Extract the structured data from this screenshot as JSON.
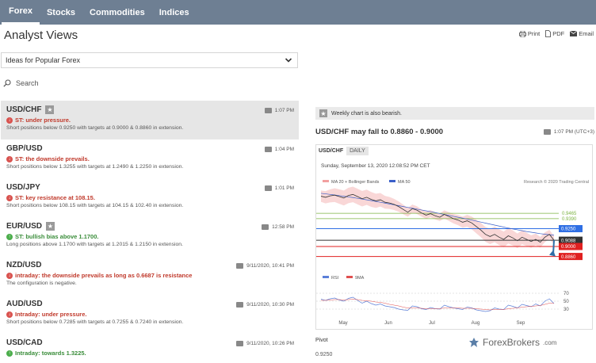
{
  "nav": {
    "tabs": [
      {
        "label": "Forex",
        "active": true
      },
      {
        "label": "Stocks",
        "active": false
      },
      {
        "label": "Commodities",
        "active": false
      },
      {
        "label": "Indices",
        "active": false
      }
    ]
  },
  "page": {
    "title": "Analyst Views"
  },
  "toolbar": {
    "print": "Print",
    "pdf": "PDF",
    "email": "Email"
  },
  "filter": {
    "selected": "Ideas for Popular Forex"
  },
  "search": {
    "label": "Search"
  },
  "ideas": [
    {
      "pair": "USD/CHF",
      "star": true,
      "time": "1:07 PM",
      "direction": "down",
      "headline": "ST: under pressure.",
      "desc": "Short positions below 0.9250 with targets at 0.9000 & 0.8860 in extension."
    },
    {
      "pair": "GBP/USD",
      "star": false,
      "time": "1:04 PM",
      "direction": "down",
      "headline": "ST: the downside prevails.",
      "desc": "Short positions below 1.3255 with targets at 1.2490 & 1.2250 in extension."
    },
    {
      "pair": "USD/JPY",
      "star": false,
      "time": "1:01 PM",
      "direction": "down",
      "headline": "ST: key resistance at 108.15.",
      "desc": "Short positions below 108.15 with targets at 104.15 & 102.40 in extension."
    },
    {
      "pair": "EUR/USD",
      "star": true,
      "time": "12:58 PM",
      "direction": "up",
      "headline": "ST: bullish bias above 1.1700.",
      "desc": "Long positions above 1.1700 with targets at 1.2015 & 1.2150 in extension."
    },
    {
      "pair": "NZD/USD",
      "star": false,
      "time": "9/11/2020, 10:41 PM",
      "direction": "down",
      "headline": "intraday: the downside prevails as long as 0.6687 is resistance",
      "desc": "The configuration is negative."
    },
    {
      "pair": "AUD/USD",
      "star": false,
      "time": "9/11/2020, 10:30 PM",
      "direction": "down",
      "headline": "Intraday: under pressure.",
      "desc": "Short positions below 0.7285 with targets at 0.7255 & 0.7240 in extension."
    },
    {
      "pair": "USD/CAD",
      "star": false,
      "time": "9/11/2020, 10:26 PM",
      "direction": "up",
      "headline": "Intraday: towards 1.3225.",
      "desc": ""
    }
  ],
  "detail": {
    "note": "Weekly chart is also bearish.",
    "title": "USD/CHF may fall to 0.8860 - 0.9000",
    "time": "1:07 PM (UTC+3)",
    "pivot_label": "Pivot",
    "pivot_value": "0.9250"
  },
  "chart_data": {
    "type": "line",
    "symbol": "USD/CHF",
    "timeframe": "DAILY",
    "date": "Sunday, September 13, 2020 12:08:52 PM CET",
    "legend": [
      "MA 20 + Bollinger Bands",
      "MA 50"
    ],
    "credit": "Research © 2020 Trading Central",
    "x_labels": [
      "May",
      "Jun",
      "Jul",
      "Aug",
      "Sep"
    ],
    "levels": [
      {
        "value": 0.9465,
        "color": "#7cb342"
      },
      {
        "value": 0.939,
        "color": "#7cb342"
      },
      {
        "value": 0.925,
        "color": "#2f6fe4"
      },
      {
        "value": 0.9088,
        "color": "#333333"
      },
      {
        "value": 0.9,
        "color": "#e02020"
      },
      {
        "value": 0.886,
        "color": "#e02020"
      }
    ],
    "ylim": [
      0.88,
      0.98
    ],
    "price": [
      0.9705,
      0.969,
      0.971,
      0.972,
      0.97,
      0.968,
      0.9715,
      0.973,
      0.97,
      0.967,
      0.969,
      0.966,
      0.964,
      0.9655,
      0.962,
      0.961,
      0.959,
      0.956,
      0.952,
      0.948,
      0.953,
      0.951,
      0.947,
      0.944,
      0.946,
      0.943,
      0.941,
      0.945,
      0.942,
      0.939,
      0.937,
      0.934,
      0.936,
      0.933,
      0.928,
      0.923,
      0.917,
      0.914,
      0.917,
      0.913,
      0.91,
      0.915,
      0.912,
      0.908,
      0.913,
      0.91,
      0.907,
      0.91,
      0.906,
      0.913,
      0.917,
      0.9088
    ],
    "ma50": [
      0.9745,
      0.9738,
      0.973,
      0.9722,
      0.9713,
      0.9704,
      0.9695,
      0.9686,
      0.9676,
      0.9665,
      0.9654,
      0.9643,
      0.9632,
      0.962,
      0.9608,
      0.9596,
      0.9584,
      0.9572,
      0.956,
      0.9548,
      0.9536,
      0.9524,
      0.9512,
      0.95,
      0.9488,
      0.9475,
      0.9462,
      0.9449,
      0.9436,
      0.9423,
      0.941,
      0.9397,
      0.9384,
      0.937,
      0.9356,
      0.9342,
      0.9328,
      0.9314,
      0.93,
      0.9286,
      0.9272,
      0.9258,
      0.9246,
      0.9234,
      0.9222,
      0.921,
      0.92,
      0.919,
      0.918,
      0.9172,
      0.9165,
      0.9158
    ],
    "rsi_legend": [
      "RSI",
      "9MA"
    ],
    "rsi_levels": [
      70,
      50,
      30
    ],
    "rsi": [
      55,
      52,
      56,
      58,
      53,
      50,
      57,
      60,
      52,
      45,
      50,
      44,
      40,
      43,
      38,
      36,
      34,
      30,
      28,
      27,
      38,
      36,
      31,
      29,
      34,
      31,
      30,
      40,
      36,
      33,
      31,
      29,
      35,
      33,
      28,
      26,
      24,
      26,
      33,
      30,
      29,
      40,
      37,
      33,
      42,
      39,
      36,
      43,
      38,
      50,
      56,
      44
    ],
    "rsi_ma": [
      52,
      52,
      53,
      54,
      54,
      53,
      54,
      55,
      54,
      52,
      51,
      50,
      48,
      47,
      45,
      42,
      40,
      38,
      35,
      33,
      33,
      33,
      32,
      31,
      31,
      31,
      31,
      33,
      33,
      33,
      33,
      32,
      32,
      32,
      31,
      30,
      29,
      28,
      29,
      29,
      29,
      31,
      32,
      33,
      35,
      36,
      37,
      38,
      39,
      42,
      45,
      45
    ]
  },
  "watermark": {
    "text": "ForexBrokers",
    "suffix": ".com"
  }
}
